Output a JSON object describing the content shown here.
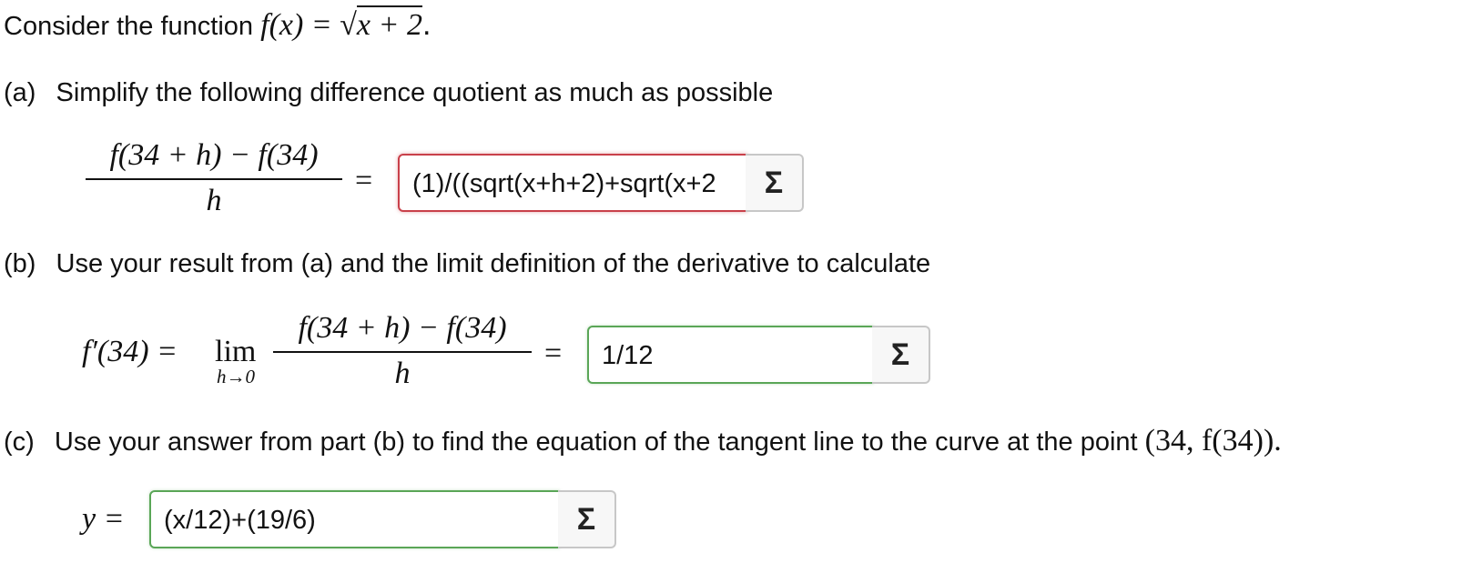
{
  "intro": {
    "text": "Consider the function",
    "function_lhs": "f(x) = ",
    "sqrt_arg": "x + 2",
    "period": "."
  },
  "part_a": {
    "label": "(a)",
    "text": "Simplify the following difference quotient as much as possible",
    "numerator": "f(34 + h) − f(34)",
    "denominator": "h",
    "equals": "=",
    "answer": "(1)/((sqrt(x+h+2)+sqrt(x+2",
    "status": "incorrect",
    "sigma": "Σ"
  },
  "part_b": {
    "label": "(b)",
    "text": "Use your result from (a) and the limit definition of the derivative to calculate",
    "lhs": "f′(34) = ",
    "lim": "lim",
    "lim_sub": "h→0",
    "numerator": "f(34 + h) − f(34)",
    "denominator": "h",
    "equals": "=",
    "answer": "1/12",
    "status": "correct",
    "sigma": "Σ"
  },
  "part_c": {
    "label": "(c)",
    "text": "Use your answer from part (b) to find the equation of the tangent line to the curve at the point",
    "point": "(34, f(34)).",
    "lhs": "y = ",
    "answer": "(x/12)+(19/6)",
    "status": "correct",
    "sigma": "Σ"
  },
  "colors": {
    "incorrect_border": "#c9404a",
    "correct_border": "#5aa657"
  },
  "icons": {
    "sigma_button": "sigma-icon"
  }
}
